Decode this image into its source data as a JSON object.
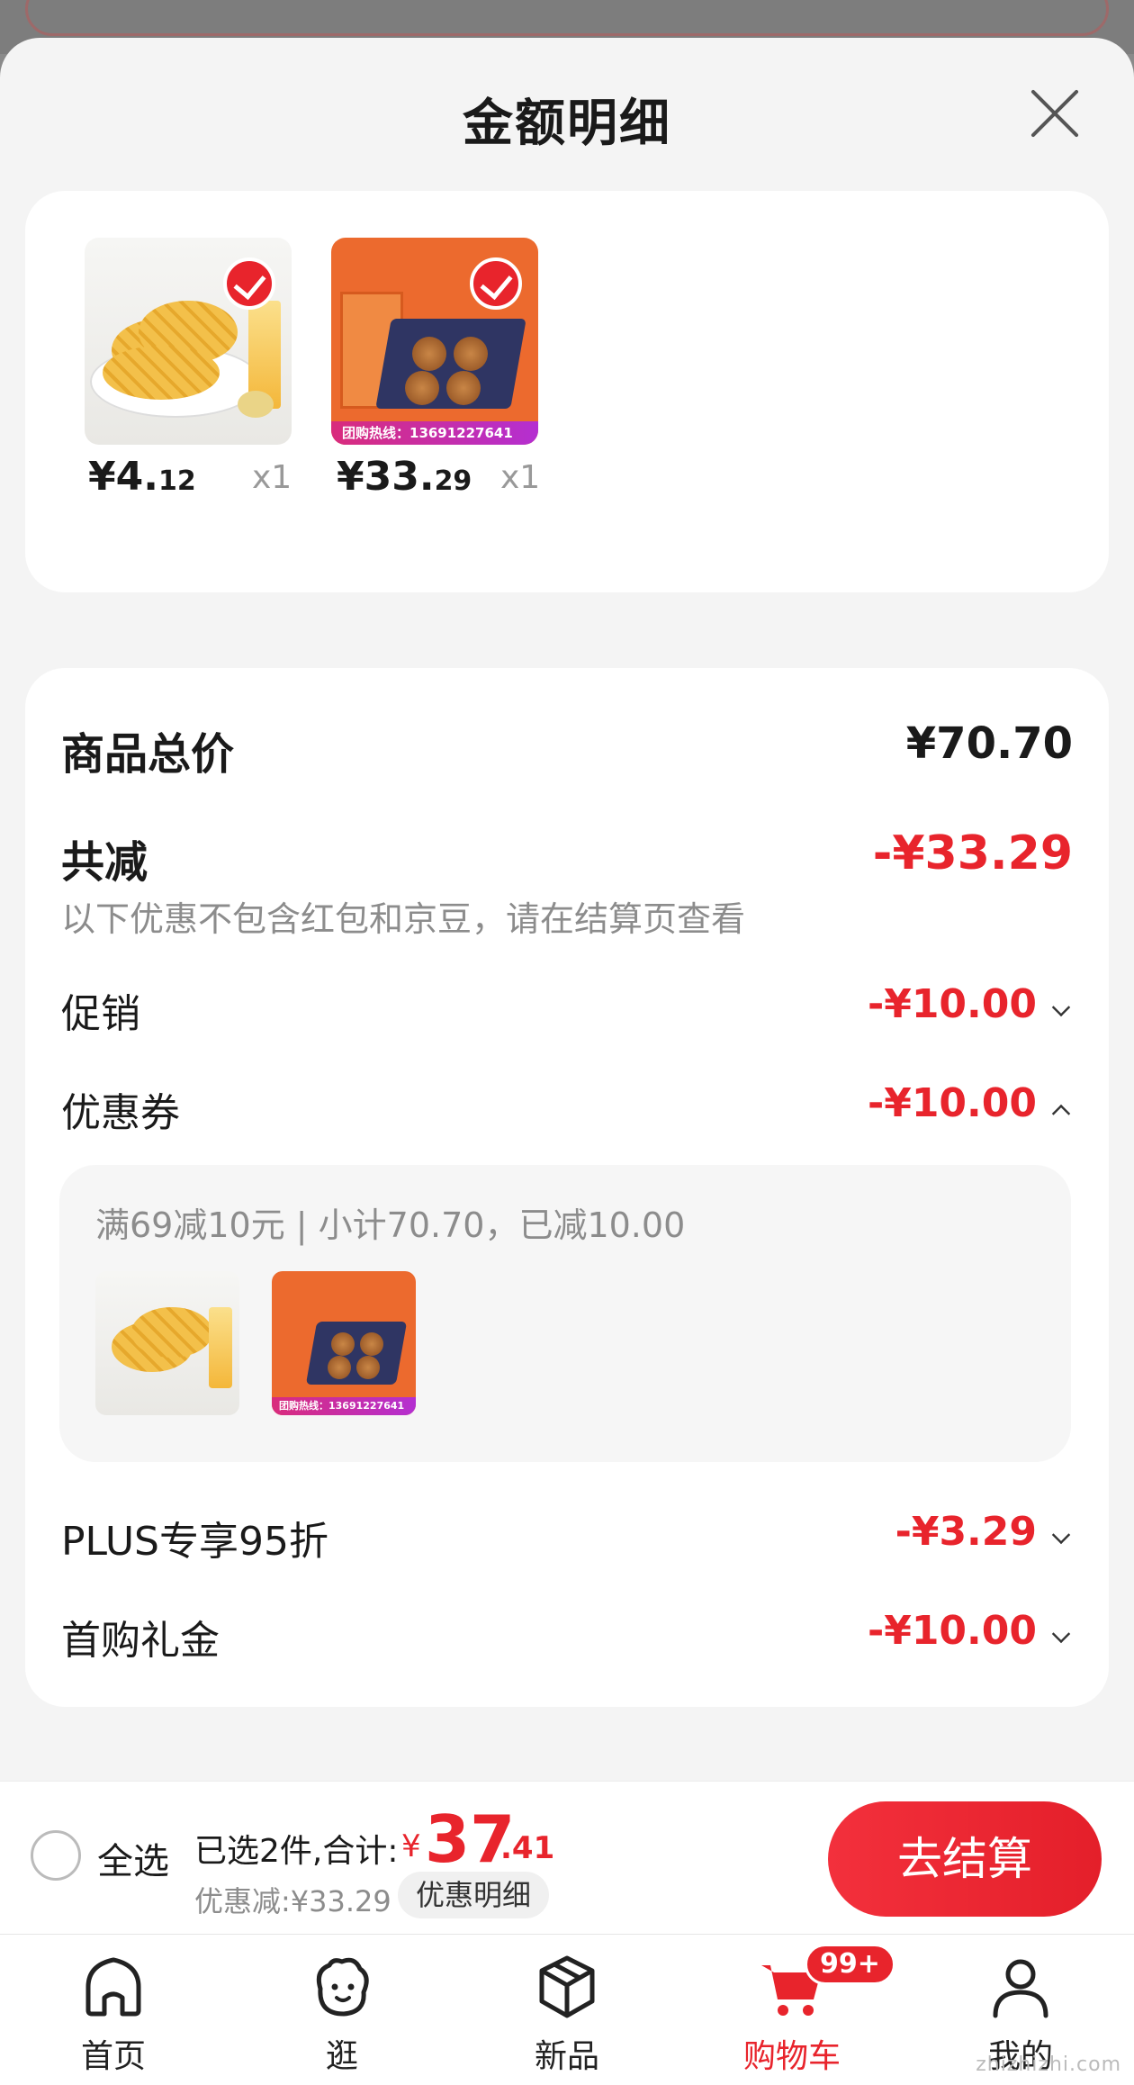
{
  "sheet": {
    "title": "金额明细",
    "products": [
      {
        "price_int": "¥4.",
        "price_dec": "12",
        "qty": "x1",
        "image": "potato-chips-image"
      },
      {
        "price_int": "¥33.",
        "price_dec": "29",
        "qty": "x1",
        "image": "mooncake-giftbox-image",
        "hotline_text": "团购热线：13691227641"
      }
    ]
  },
  "detail": {
    "total_label": "商品总价",
    "total_value": "¥70.70",
    "reduce_label": "共减",
    "reduce_value": "-¥33.29",
    "note": "以下优惠不包含红包和京豆，请在结算页查看",
    "promo_label": "促销",
    "promo_value": "-¥10.00",
    "coupon_label": "优惠券",
    "coupon_value": "-¥10.00",
    "coupon_desc": "满69减10元 | 小计70.70，已减10.00",
    "coupon_hotline": "团购热线：13691227641",
    "plus_label": "PLUS专享95折",
    "plus_value": "-¥3.29",
    "first_label": "首购礼金",
    "first_value": "-¥10.00"
  },
  "bottom_bar": {
    "select_all": "全选",
    "selected_text": "已选2件,合计:",
    "currency": "¥",
    "total_int": "37",
    "total_dec": ".41",
    "discount_text": "优惠减:¥33.29",
    "detail_chip": "优惠明细",
    "checkout": "去结算"
  },
  "tabbar": {
    "tabs": [
      {
        "label": "首页",
        "icon": "home-icon"
      },
      {
        "label": "逛",
        "icon": "browse-icon"
      },
      {
        "label": "新品",
        "icon": "new-products-icon"
      },
      {
        "label": "购物车",
        "icon": "cart-icon",
        "badge": "99+",
        "active": true
      },
      {
        "label": "我的",
        "icon": "profile-icon"
      }
    ]
  },
  "watermark": "zhizhizhi.com",
  "colors": {
    "accent": "#e8242c",
    "muted": "#8c8c8c",
    "sheet_bg": "#f4f4f4"
  }
}
